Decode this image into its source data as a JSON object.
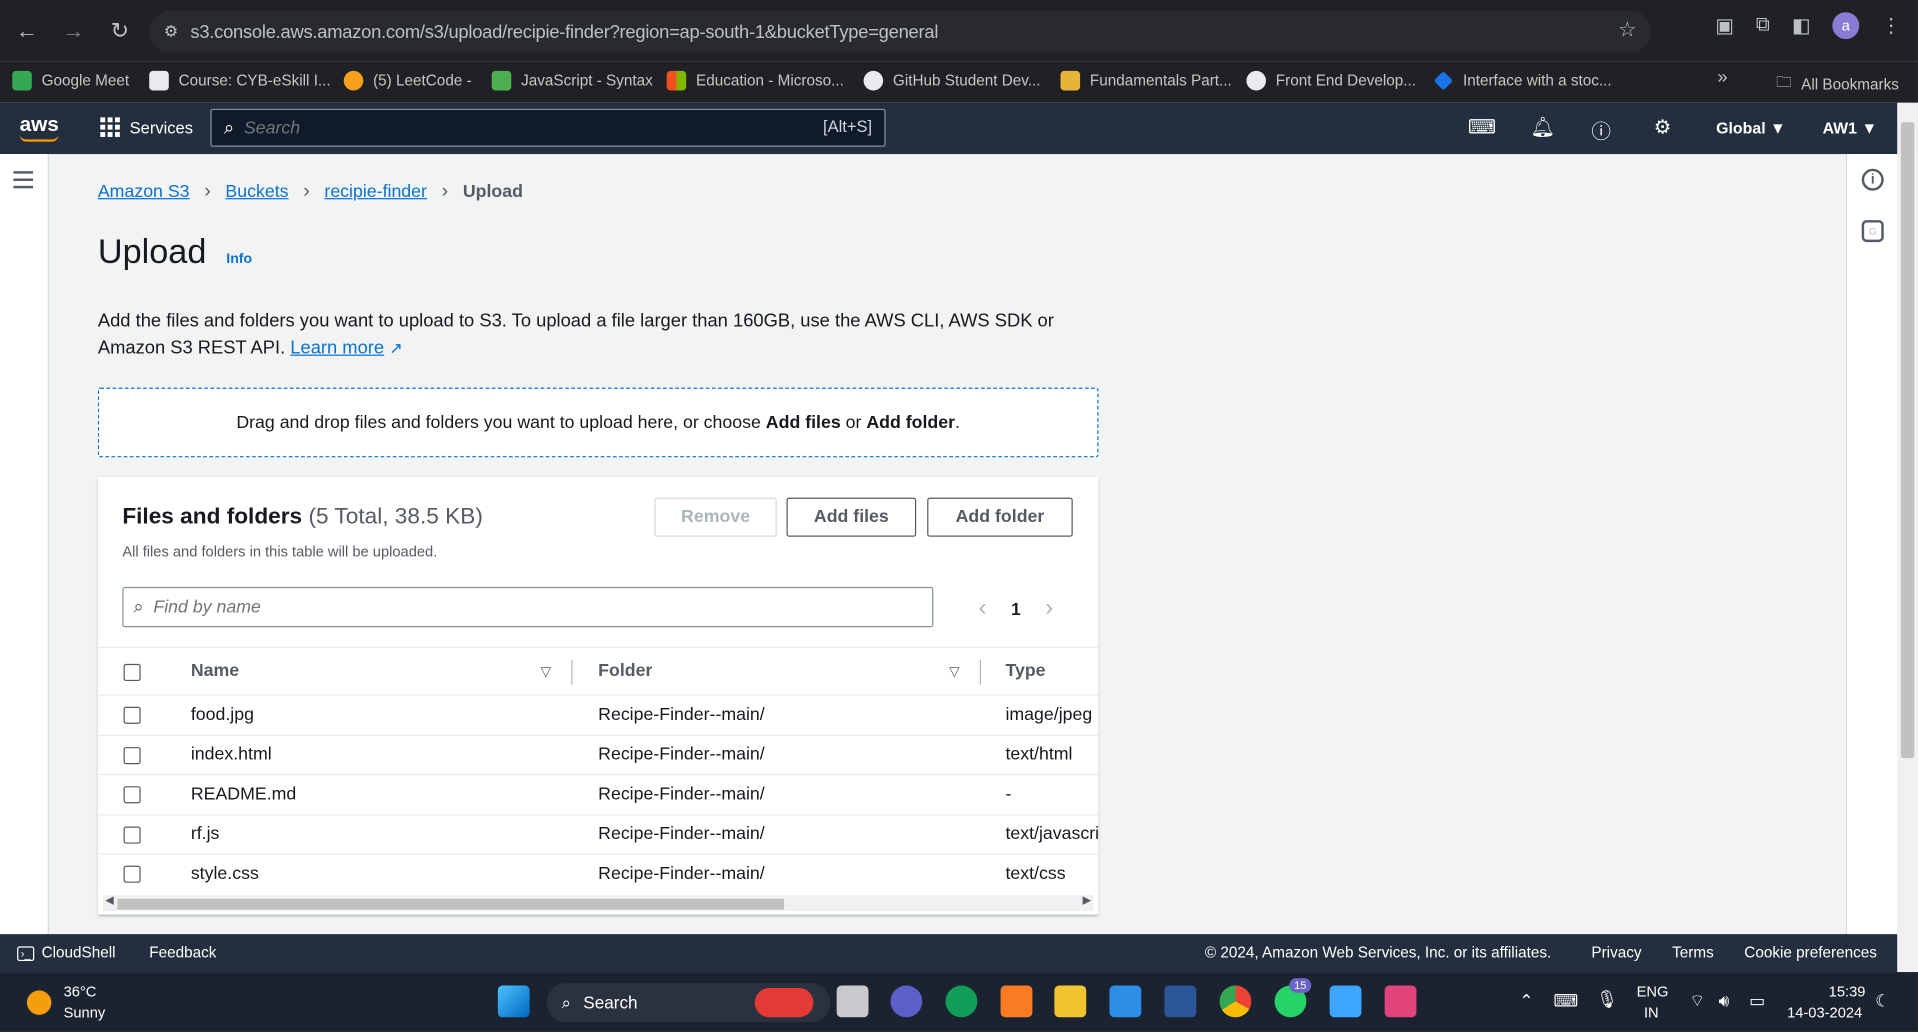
{
  "browser": {
    "url": "s3.console.aws.amazon.com/s3/upload/recipie-finder?region=ap-south-1&bucketType=general",
    "avatar_letter": "a",
    "bookmarks": [
      {
        "label": "Google Meet",
        "color": "#34a853"
      },
      {
        "label": "Course: CYB-eSkill I...",
        "color": "#ffffff"
      },
      {
        "label": "(5) LeetCode -",
        "color": "#f89f1b"
      },
      {
        "label": "JavaScript - Syntax",
        "color": "#4caf50"
      },
      {
        "label": "Education - Microso...",
        "color": "#f25022"
      },
      {
        "label": "GitHub Student Dev...",
        "color": "#ffffff"
      },
      {
        "label": "Fundamentals Part...",
        "color": "#e8b339"
      },
      {
        "label": "Front End Develop...",
        "color": "#ffffff"
      },
      {
        "label": "Interface with a stoc...",
        "color": "#1a73e8"
      }
    ],
    "all_bookmarks": "All Bookmarks"
  },
  "aws_nav": {
    "logo": "aws",
    "services": "Services",
    "search_placeholder": "Search",
    "search_shortcut": "[Alt+S]",
    "region": "Global ▼",
    "account": "AW1 ▼"
  },
  "breadcrumb": {
    "items": [
      "Amazon S3",
      "Buckets",
      "recipie-finder"
    ],
    "current": "Upload"
  },
  "page": {
    "title": "Upload",
    "info": "Info",
    "description": "Add the files and folders you want to upload to S3. To upload a file larger than 160GB, use the AWS CLI, AWS SDK or Amazon S3 REST API.",
    "learn_more": "Learn more",
    "dropzone_prefix": "Drag and drop files and folders you want to upload here, or choose ",
    "dropzone_add_files": "Add files",
    "dropzone_or": " or ",
    "dropzone_add_folder": "Add folder",
    "dropzone_suffix": "."
  },
  "files_panel": {
    "title": "Files and folders",
    "count": "(5 Total, 38.5 KB)",
    "subtitle": "All files and folders in this table will be uploaded.",
    "remove": "Remove",
    "add_files": "Add files",
    "add_folder": "Add folder",
    "filter_placeholder": "Find by name",
    "page_number": "1",
    "columns": [
      "Name",
      "Folder",
      "Type"
    ],
    "rows": [
      {
        "name": "food.jpg",
        "folder": "Recipe-Finder--main/",
        "type": "image/jpeg"
      },
      {
        "name": "index.html",
        "folder": "Recipe-Finder--main/",
        "type": "text/html"
      },
      {
        "name": "README.md",
        "folder": "Recipe-Finder--main/",
        "type": "-"
      },
      {
        "name": "rf.js",
        "folder": "Recipe-Finder--main/",
        "type": "text/javascri"
      },
      {
        "name": "style.css",
        "folder": "Recipe-Finder--main/",
        "type": "text/css"
      }
    ]
  },
  "footer": {
    "cloudshell": "CloudShell",
    "feedback": "Feedback",
    "copyright": "© 2024, Amazon Web Services, Inc. or its affiliates.",
    "privacy": "Privacy",
    "terms": "Terms",
    "cookie": "Cookie preferences"
  },
  "taskbar": {
    "temperature": "36°C",
    "weather": "Sunny",
    "search": "Search",
    "whatsapp_badge": "15",
    "lang": "ENG",
    "region": "IN",
    "time": "15:39",
    "date": "14-03-2024"
  }
}
